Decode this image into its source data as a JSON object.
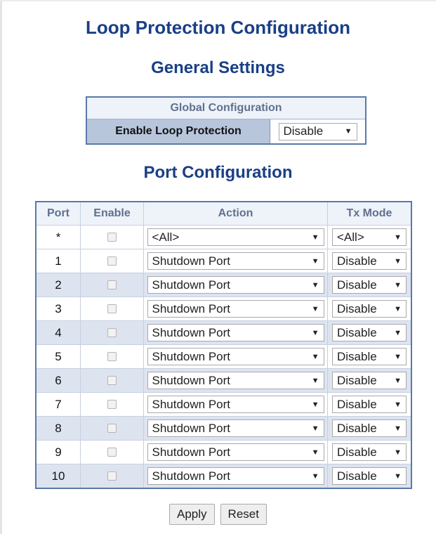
{
  "title": "Loop Protection Configuration",
  "general_settings": {
    "heading": "General Settings",
    "table_header": "Global Configuration",
    "enable_label": "Enable Loop Protection",
    "enable_value": "Disable"
  },
  "port_configuration": {
    "heading": "Port Configuration",
    "columns": {
      "port": "Port",
      "enable": "Enable",
      "action": "Action",
      "tx_mode": "Tx Mode"
    },
    "all_row": {
      "port": "*",
      "action": "<All>",
      "tx_mode": "<All>"
    },
    "rows": [
      {
        "port": "1",
        "action": "Shutdown Port",
        "tx_mode": "Disable"
      },
      {
        "port": "2",
        "action": "Shutdown Port",
        "tx_mode": "Disable"
      },
      {
        "port": "3",
        "action": "Shutdown Port",
        "tx_mode": "Disable"
      },
      {
        "port": "4",
        "action": "Shutdown Port",
        "tx_mode": "Disable"
      },
      {
        "port": "5",
        "action": "Shutdown Port",
        "tx_mode": "Disable"
      },
      {
        "port": "6",
        "action": "Shutdown Port",
        "tx_mode": "Disable"
      },
      {
        "port": "7",
        "action": "Shutdown Port",
        "tx_mode": "Disable"
      },
      {
        "port": "8",
        "action": "Shutdown Port",
        "tx_mode": "Disable"
      },
      {
        "port": "9",
        "action": "Shutdown Port",
        "tx_mode": "Disable"
      },
      {
        "port": "10",
        "action": "Shutdown Port",
        "tx_mode": "Disable"
      }
    ]
  },
  "buttons": {
    "apply": "Apply",
    "reset": "Reset"
  },
  "icons": {
    "dropdown": "dropdown-arrow-icon"
  },
  "colors": {
    "heading": "#1a3f86",
    "table_border": "#5a79a8",
    "label_bg": "#b8c6dc",
    "alt_row": "#dde4ef"
  }
}
